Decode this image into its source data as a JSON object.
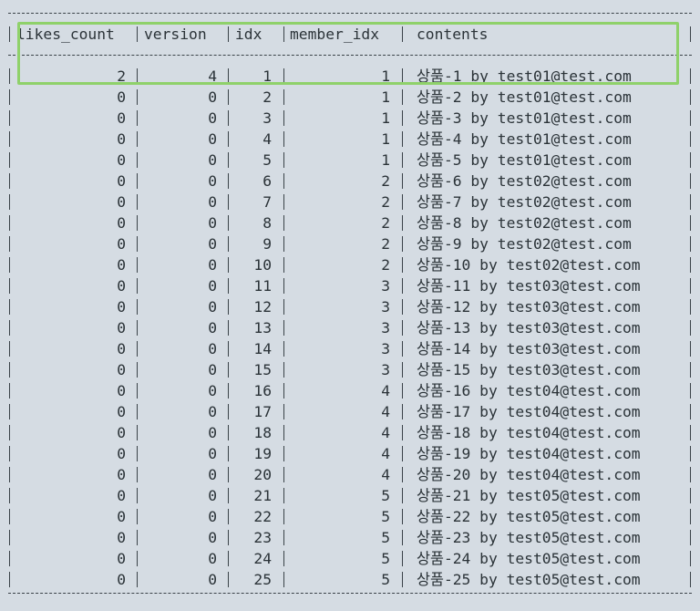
{
  "table": {
    "columns": [
      "likes_count",
      "version",
      "idx",
      "member_idx",
      "contents"
    ],
    "rows": [
      [
        "2",
        "4",
        "1",
        "1",
        "상품-1 by test01@test.com"
      ],
      [
        "0",
        "0",
        "2",
        "1",
        "상품-2 by test01@test.com"
      ],
      [
        "0",
        "0",
        "3",
        "1",
        "상품-3 by test01@test.com"
      ],
      [
        "0",
        "0",
        "4",
        "1",
        "상품-4 by test01@test.com"
      ],
      [
        "0",
        "0",
        "5",
        "1",
        "상품-5 by test01@test.com"
      ],
      [
        "0",
        "0",
        "6",
        "2",
        "상품-6 by test02@test.com"
      ],
      [
        "0",
        "0",
        "7",
        "2",
        "상품-7 by test02@test.com"
      ],
      [
        "0",
        "0",
        "8",
        "2",
        "상품-8 by test02@test.com"
      ],
      [
        "0",
        "0",
        "9",
        "2",
        "상품-9 by test02@test.com"
      ],
      [
        "0",
        "0",
        "10",
        "2",
        "상품-10 by test02@test.com"
      ],
      [
        "0",
        "0",
        "11",
        "3",
        "상품-11 by test03@test.com"
      ],
      [
        "0",
        "0",
        "12",
        "3",
        "상품-12 by test03@test.com"
      ],
      [
        "0",
        "0",
        "13",
        "3",
        "상품-13 by test03@test.com"
      ],
      [
        "0",
        "0",
        "14",
        "3",
        "상품-14 by test03@test.com"
      ],
      [
        "0",
        "0",
        "15",
        "3",
        "상품-15 by test03@test.com"
      ],
      [
        "0",
        "0",
        "16",
        "4",
        "상품-16 by test04@test.com"
      ],
      [
        "0",
        "0",
        "17",
        "4",
        "상품-17 by test04@test.com"
      ],
      [
        "0",
        "0",
        "18",
        "4",
        "상품-18 by test04@test.com"
      ],
      [
        "0",
        "0",
        "19",
        "4",
        "상품-19 by test04@test.com"
      ],
      [
        "0",
        "0",
        "20",
        "4",
        "상품-20 by test04@test.com"
      ],
      [
        "0",
        "0",
        "21",
        "5",
        "상품-21 by test05@test.com"
      ],
      [
        "0",
        "0",
        "22",
        "5",
        "상품-22 by test05@test.com"
      ],
      [
        "0",
        "0",
        "23",
        "5",
        "상품-23 by test05@test.com"
      ],
      [
        "0",
        "0",
        "24",
        "5",
        "상품-24 by test05@test.com"
      ],
      [
        "0",
        "0",
        "25",
        "5",
        "상품-25 by test05@test.com"
      ]
    ]
  },
  "colors": {
    "background": "#d5dce3",
    "text": "#2b3338",
    "highlight": "#8fd16a"
  }
}
